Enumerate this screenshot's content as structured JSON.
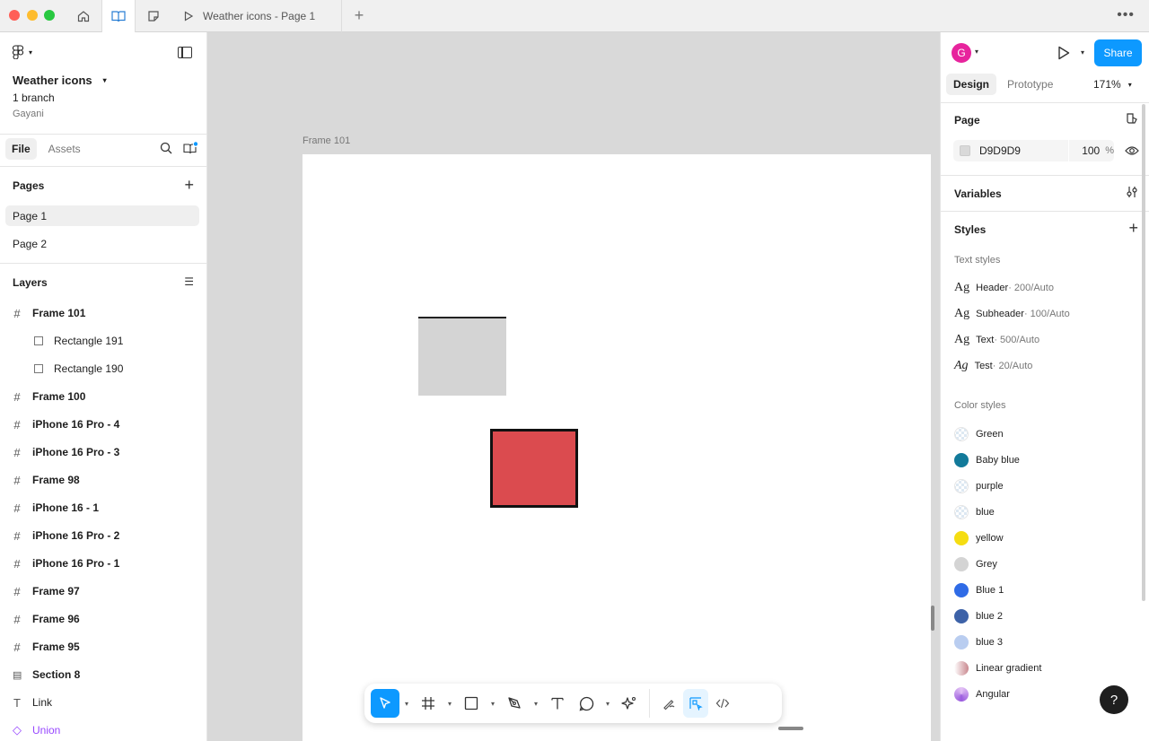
{
  "titlebar": {
    "tab_title": "Weather icons - Page 1",
    "icons": [
      "home-icon",
      "book-icon",
      "sticky-note-icon",
      "play-icon",
      "plus-icon",
      "more-icon"
    ]
  },
  "left_panel": {
    "file_name": "Weather icons",
    "branch": "1 branch",
    "owner": "Gayani",
    "tabs": {
      "file": "File",
      "assets": "Assets"
    },
    "pages_header": "Pages",
    "pages": [
      {
        "label": "Page 1",
        "active": true
      },
      {
        "label": "Page 2",
        "active": false
      }
    ],
    "layers_header": "Layers",
    "layers": [
      {
        "label": "Frame 101",
        "type": "frame"
      },
      {
        "label": "Rectangle 191",
        "type": "rect"
      },
      {
        "label": "Rectangle 190",
        "type": "rect"
      },
      {
        "label": "Frame 100",
        "type": "frame"
      },
      {
        "label": "iPhone 16 Pro - 4",
        "type": "frame"
      },
      {
        "label": "iPhone 16 Pro - 3",
        "type": "frame"
      },
      {
        "label": "Frame 98",
        "type": "frame"
      },
      {
        "label": "iPhone 16 - 1",
        "type": "frame"
      },
      {
        "label": "iPhone 16 Pro - 2",
        "type": "frame"
      },
      {
        "label": "iPhone 16 Pro - 1",
        "type": "frame"
      },
      {
        "label": "Frame 97",
        "type": "frame"
      },
      {
        "label": "Frame 96",
        "type": "frame"
      },
      {
        "label": "Frame 95",
        "type": "frame"
      },
      {
        "label": "Section 8",
        "type": "section"
      },
      {
        "label": "Link",
        "type": "text"
      },
      {
        "label": "Union",
        "type": "component"
      }
    ]
  },
  "canvas": {
    "frame_label": "Frame 101"
  },
  "right_panel": {
    "avatar_initial": "G",
    "share_label": "Share",
    "tabs": {
      "design": "Design",
      "prototype": "Prototype"
    },
    "zoom": "171%",
    "page_section": "Page",
    "page_fill": {
      "hex": "D9D9D9",
      "opacity": "100",
      "unit": "%"
    },
    "variables_section": "Variables",
    "styles_section": "Styles",
    "text_styles_header": "Text styles",
    "text_styles": [
      {
        "ag": "Ag",
        "name": "Header",
        "meta": " · 200/Auto"
      },
      {
        "ag": "Ag",
        "name": "Subheader",
        "meta": " · 100/Auto"
      },
      {
        "ag": "Ag",
        "name": "Text",
        "meta": " · 500/Auto"
      },
      {
        "ag": "Ag",
        "name": "Test",
        "meta": " · 20/Auto"
      }
    ],
    "color_styles_header": "Color styles",
    "color_styles": [
      {
        "name": "Green",
        "color": "checker"
      },
      {
        "name": "Baby blue",
        "color": "#127a9a"
      },
      {
        "name": "purple",
        "color": "checker"
      },
      {
        "name": "blue",
        "color": "checker"
      },
      {
        "name": "yellow",
        "color": "#f5dd12"
      },
      {
        "name": "Grey",
        "color": "#d4d4d4"
      },
      {
        "name": "Blue 1",
        "color": "#2f6be6"
      },
      {
        "name": "blue 2",
        "color": "#3d62a8"
      },
      {
        "name": "blue 3",
        "color": "#b9cdf0"
      },
      {
        "name": "Linear gradient",
        "color": "linear-gradient(90deg,#ffffff,#c9888f)"
      },
      {
        "name": "Angular",
        "color": "conic-gradient(#e3c2f5,#9a5bde,#e3c2f5)"
      }
    ],
    "help_label": "?"
  },
  "colors": {
    "accent": "#0d99ff",
    "canvas_bg": "#d9d9d9",
    "red_rect": "#db4b4f",
    "grey_rect": "#d4d4d4"
  }
}
